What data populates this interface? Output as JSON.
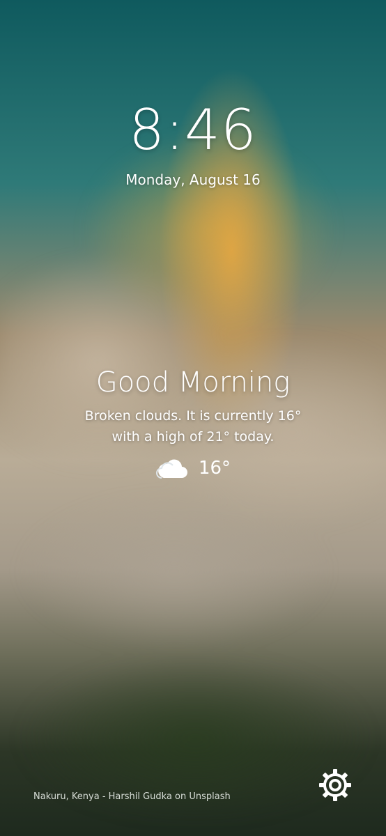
{
  "clock": {
    "time": "8:46",
    "date": "Monday, August 16"
  },
  "greeting": {
    "title": "Good Morning",
    "line1": "Broken clouds. It is currently 16°",
    "line2": "with a high of 21° today."
  },
  "weather": {
    "icon": "cloud-icon",
    "temperature": "16°"
  },
  "footer": {
    "photo_credit": "Nakuru, Kenya - Harshil Gudka on Unsplash",
    "settings_icon": "gear-icon"
  }
}
